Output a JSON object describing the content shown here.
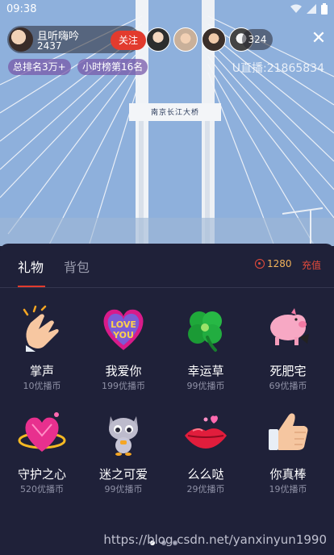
{
  "status": {
    "time": "09:38"
  },
  "anchor": {
    "name": "且听嗨吟",
    "number": "2437",
    "follow_label": "关注"
  },
  "viewers": {
    "count": "324"
  },
  "tags": {
    "rank": "总排名3万+",
    "hour_rank": "小时榜第16名"
  },
  "room": {
    "uid": "U直播:21865834"
  },
  "scene": {
    "bridge_sign": "南京长江大桥"
  },
  "panel": {
    "tabs": [
      {
        "label": "礼物"
      },
      {
        "label": "背包"
      }
    ],
    "balance": "1280",
    "recharge_label": "充值"
  },
  "gifts": [
    {
      "name": "掌声",
      "price": "10优播币",
      "icon": "clapping-hands-icon"
    },
    {
      "name": "我爱你",
      "price": "199优播币",
      "icon": "love-you-heart-icon"
    },
    {
      "name": "幸运草",
      "price": "99优播币",
      "icon": "four-leaf-clover-icon"
    },
    {
      "name": "死肥宅",
      "price": "69优播币",
      "icon": "pink-pig-icon"
    },
    {
      "name": "守护之心",
      "price": "520优播币",
      "icon": "diamond-heart-icon"
    },
    {
      "name": "迷之可爱",
      "price": "99优播币",
      "icon": "cute-cat-icon"
    },
    {
      "name": "么么哒",
      "price": "29优播币",
      "icon": "kiss-lips-icon"
    },
    {
      "name": "你真棒",
      "price": "19优播币",
      "icon": "thumbs-up-icon"
    }
  ],
  "watermark": "https://blog.csdn.net/yanxinyun1990",
  "colors": {
    "accent": "#e23b2e",
    "panel_bg": "#1f2139",
    "coin": "#f3b35a"
  }
}
